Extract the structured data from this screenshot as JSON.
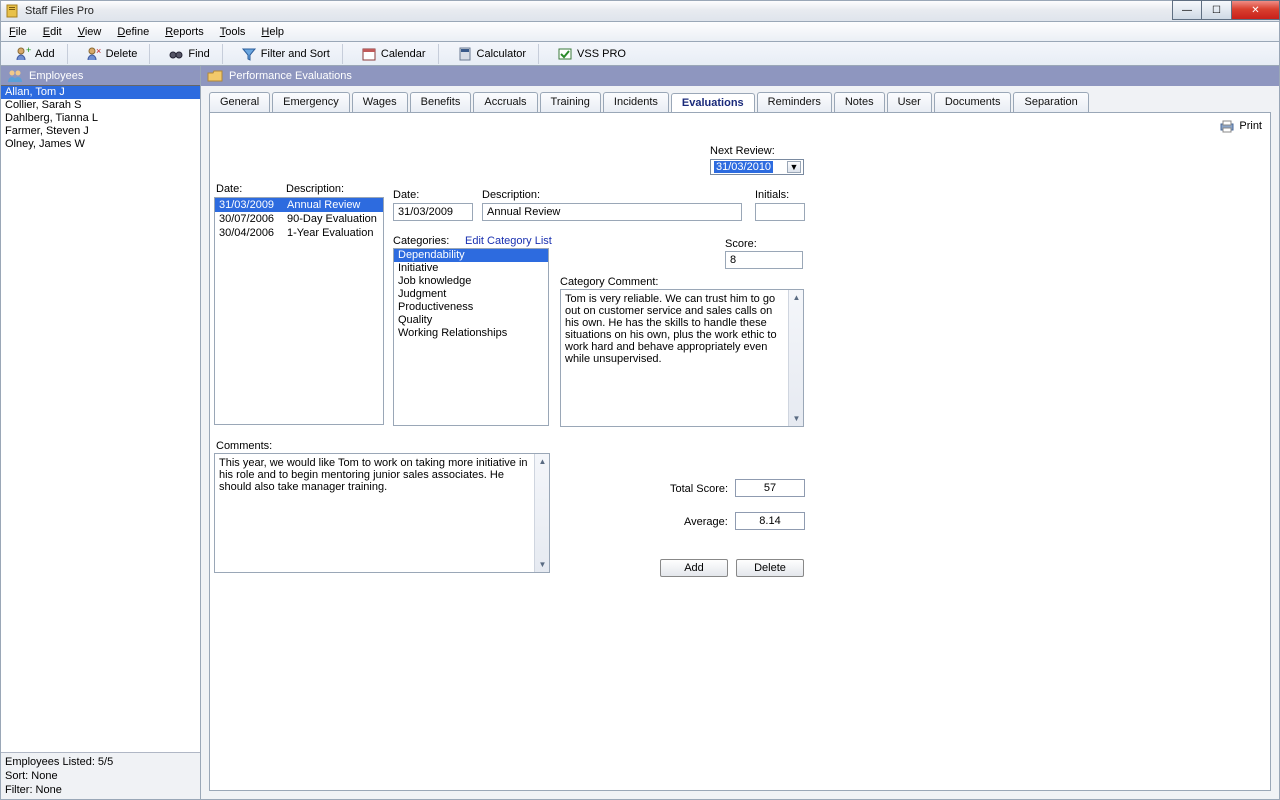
{
  "window": {
    "title": "Staff Files Pro"
  },
  "menubar": [
    "File",
    "Edit",
    "View",
    "Define",
    "Reports",
    "Tools",
    "Help"
  ],
  "toolbar": {
    "add": "Add",
    "delete": "Delete",
    "find": "Find",
    "filter": "Filter and Sort",
    "calendar": "Calendar",
    "calculator": "Calculator",
    "vss": "VSS PRO"
  },
  "sidebar": {
    "title": "Employees",
    "items": [
      {
        "name": "Allan, Tom J",
        "selected": true
      },
      {
        "name": "Collier, Sarah S"
      },
      {
        "name": "Dahlberg, Tianna L"
      },
      {
        "name": "Farmer, Steven J"
      },
      {
        "name": "Olney, James W"
      }
    ],
    "status": {
      "listed": "Employees Listed: 5/5",
      "sort": "Sort: None",
      "filter": "Filter: None"
    }
  },
  "content": {
    "title": "Performance Evaluations",
    "print": "Print",
    "tabs": [
      "General",
      "Emergency",
      "Wages",
      "Benefits",
      "Accruals",
      "Training",
      "Incidents",
      "Evaluations",
      "Reminders",
      "Notes",
      "User",
      "Documents",
      "Separation"
    ],
    "active_tab": "Evaluations",
    "next_review_label": "Next Review:",
    "next_review_value": "31/03/2010",
    "list_headers": {
      "date": "Date:",
      "desc": "Description:"
    },
    "evaluations": [
      {
        "date": "31/03/2009",
        "desc": "Annual Review",
        "selected": true
      },
      {
        "date": "30/07/2006",
        "desc": "90-Day Evaluation"
      },
      {
        "date": "30/04/2006",
        "desc": "1-Year Evaluation"
      }
    ],
    "form": {
      "date_label": "Date:",
      "date_value": "31/03/2009",
      "desc_label": "Description:",
      "desc_value": "Annual Review",
      "initials_label": "Initials:",
      "initials_value": "",
      "categories_label": "Categories:",
      "edit_categories": "Edit Category List",
      "categories": [
        "Dependability",
        "Initiative",
        "Job knowledge",
        "Judgment",
        "Productiveness",
        "Quality",
        "Working Relationships"
      ],
      "selected_category": "Dependability",
      "score_label": "Score:",
      "score_value": "8",
      "cat_comment_label": "Category Comment:",
      "cat_comment": "Tom is very reliable. We can trust him to go out on customer service and sales calls on his own. He has the skills to handle these situations on his own, plus the work ethic to work hard and behave appropriately even while unsupervised.",
      "comments_label": "Comments:",
      "comments": "This year, we would like Tom to work on taking more initiative in his role and to begin mentoring junior sales associates. He should also take manager training.",
      "total_label": "Total Score:",
      "total_value": "57",
      "avg_label": "Average:",
      "avg_value": "8.14",
      "add_btn": "Add",
      "delete_btn": "Delete"
    }
  }
}
